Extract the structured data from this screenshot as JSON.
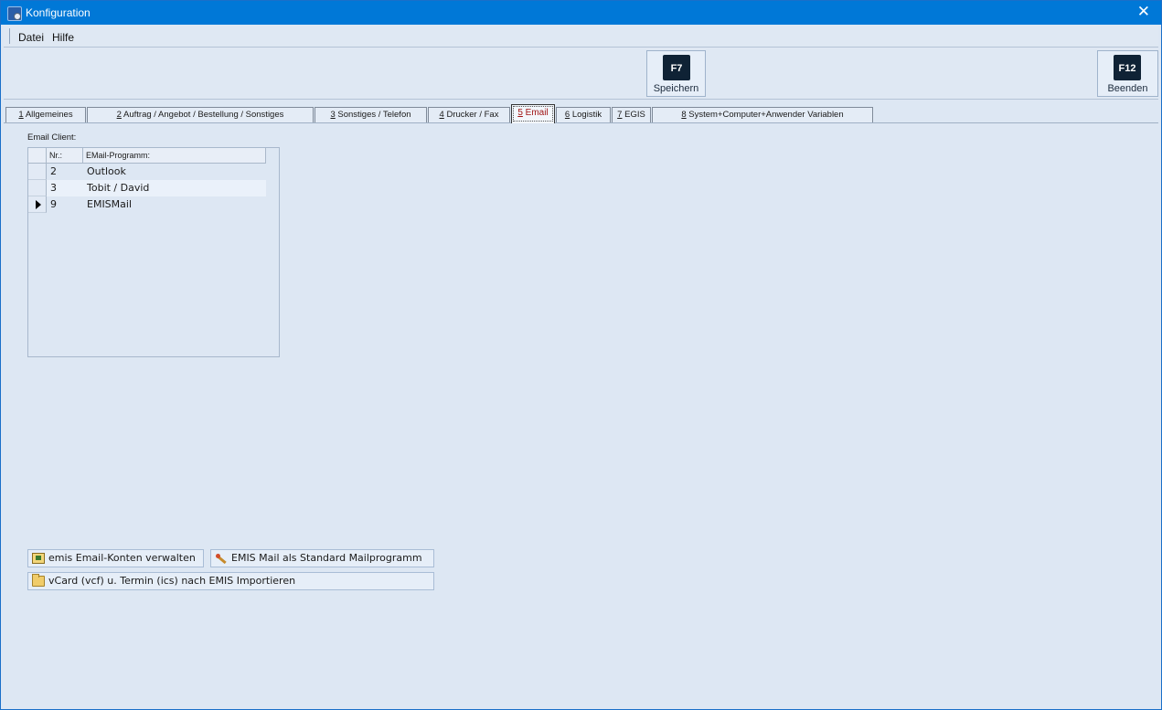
{
  "window": {
    "title": "Konfiguration",
    "close_glyph": "✕"
  },
  "menu": {
    "items": [
      "Datei",
      "Hilfe"
    ]
  },
  "toolbar": {
    "save": {
      "key": "F7",
      "label": "Speichern"
    },
    "exit": {
      "key": "F12",
      "label": "Beenden"
    }
  },
  "tabs": [
    {
      "num": "1",
      "label": "Allgemeines"
    },
    {
      "num": "2",
      "label": "Auftrag / Angebot / Bestellung / Sonstiges"
    },
    {
      "num": "3",
      "label": "Sonstiges / Telefon"
    },
    {
      "num": "4",
      "label": "Drucker / Fax"
    },
    {
      "num": "5",
      "label": "Email",
      "active": true
    },
    {
      "num": "6",
      "label": "Logistik"
    },
    {
      "num": "7",
      "label": "EGIS"
    },
    {
      "num": "8",
      "label": "System+Computer+Anwender Variablen"
    }
  ],
  "email": {
    "group_label": "Email Client:",
    "columns": [
      "Nr.:",
      "EMail-Programm:"
    ],
    "rows": [
      {
        "nr": "2",
        "program": "Outlook"
      },
      {
        "nr": "3",
        "program": "Tobit / David"
      },
      {
        "nr": "9",
        "program": "EMISMail"
      }
    ],
    "current_row_index": 2
  },
  "buttons": {
    "accounts": {
      "label": "emis Email-Konten verwalten",
      "icon": "account-book-icon"
    },
    "default_mail": {
      "label": "EMIS Mail als Standard Mailprogramm",
      "icon": "pin-icon"
    },
    "import": {
      "label": "vCard (vcf)  u. Termin (ics) nach EMIS Importieren",
      "icon": "folder-icon"
    }
  }
}
